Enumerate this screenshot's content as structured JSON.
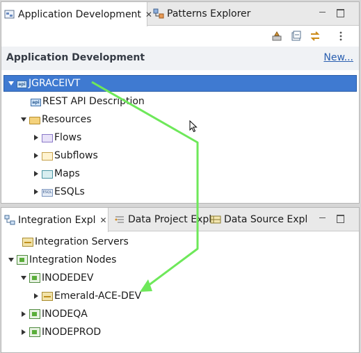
{
  "top_view": {
    "tabs": [
      {
        "label": "Application Development",
        "icon": "app-dev-icon",
        "active": true
      },
      {
        "label": "Patterns Explorer",
        "icon": "patterns-icon",
        "active": false
      }
    ],
    "close_glyph": "✕",
    "header": {
      "title": "Application Development",
      "link": "New..."
    },
    "tree": {
      "app": "JGRACEIVT",
      "rest_api": "REST API Description",
      "resources": "Resources",
      "flows": "Flows",
      "subflows": "Subflows",
      "maps": "Maps",
      "esqls": "ESQLs"
    },
    "api_badge": "api",
    "esql_badge": "ESQL"
  },
  "bottom_view": {
    "tabs": [
      {
        "label": "Integration Expl",
        "icon": "integration-explorer-icon",
        "active": true
      },
      {
        "label": "Data Project Expl",
        "icon": "data-project-icon",
        "active": false
      },
      {
        "label": "Data Source Expl",
        "icon": "data-source-icon",
        "active": false
      }
    ],
    "close_glyph": "✕",
    "tree": {
      "servers": "Integration Servers",
      "nodes": "Integration Nodes",
      "inodedev": "INODEDEV",
      "emerald": "Emerald-ACE-DEV",
      "inodeqa": "INODEQA",
      "inodeprod": "INODEPROD"
    }
  },
  "colors": {
    "selection": "#3f7ad1",
    "annotation_arrow": "#6ee85a",
    "link": "#2a5fb0"
  }
}
